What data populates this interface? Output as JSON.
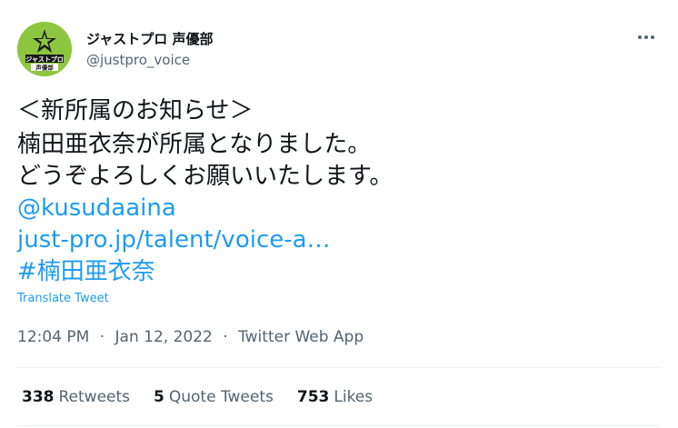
{
  "author": {
    "display_name": "ジャストプロ 声優部",
    "handle": "@justpro_voice",
    "avatar_text_top": "ジャストプロ",
    "avatar_text_bottom": "声優部",
    "avatar_color": "#8dc63f"
  },
  "tweet": {
    "lines": [
      "＜新所属のお知らせ＞",
      "楠田亜衣奈が所属となりました。",
      "どうぞよろしくお願いいたします。"
    ],
    "mention": "@kusudaaina",
    "url": "just-pro.jp/talent/voice-a…",
    "hashtag": "#楠田亜衣奈",
    "translate_label": "Translate Tweet"
  },
  "meta": {
    "time": "12:04 PM",
    "separator": "·",
    "date": "Jan 12, 2022",
    "source": "Twitter Web App"
  },
  "stats": [
    {
      "count": "338",
      "label": "Retweets"
    },
    {
      "count": "5",
      "label": "Quote Tweets"
    },
    {
      "count": "753",
      "label": "Likes"
    }
  ],
  "colors": {
    "link": "#1d9bf0",
    "secondary_text": "#536471",
    "primary_text": "#0f1419",
    "divider": "#eff3f4"
  },
  "icons": {
    "more": "more-horizontal-icon",
    "avatar_emblem": "star-icon"
  }
}
